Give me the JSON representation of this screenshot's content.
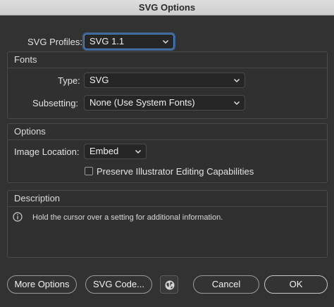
{
  "window": {
    "title": "SVG Options"
  },
  "profile": {
    "label": "SVG Profiles:",
    "value": "SVG 1.1"
  },
  "fonts": {
    "section_title": "Fonts",
    "type_label": "Type:",
    "type_value": "SVG",
    "subsetting_label": "Subsetting:",
    "subsetting_value": "None (Use System Fonts)"
  },
  "options": {
    "section_title": "Options",
    "image_location_label": "Image Location:",
    "image_location_value": "Embed",
    "preserve_label": "Preserve Illustrator Editing Capabilities",
    "preserve_checked": false
  },
  "description": {
    "section_title": "Description",
    "text": "Hold the cursor over a setting for additional information.",
    "icon": "info-icon"
  },
  "buttons": {
    "more_options": "More Options",
    "svg_code": "SVG Code...",
    "web_icon": "globe-icon",
    "cancel": "Cancel",
    "ok": "OK"
  },
  "colors": {
    "background": "#323232",
    "focus_ring": "#4b8ad6",
    "titlebar": "#d6d6d6"
  }
}
